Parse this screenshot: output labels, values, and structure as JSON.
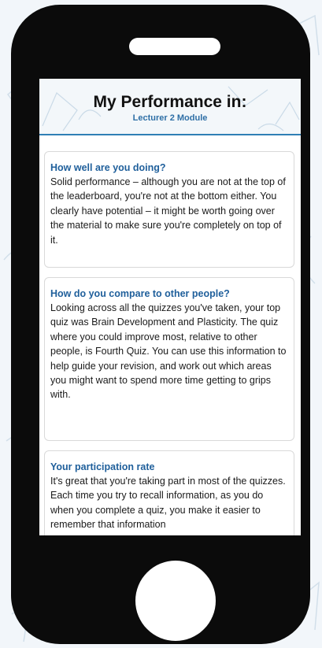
{
  "header": {
    "title": "My Performance in:",
    "subtitle": "Lecturer 2 Module"
  },
  "cards": [
    {
      "title": "How well are you doing?",
      "body": "Solid performance – although you are not at the top of the leaderboard, you're not at the bottom either. You clearly have potential – it might be worth going over the material to make sure you're completely on top of it."
    },
    {
      "title": "How do you compare to other people?",
      "body": "Looking across all the quizzes you've taken, your top quiz was Brain Development and Plasticity. The quiz where you could improve most, relative to other people, is Fourth Quiz. You can use this information to help guide your revision, and work out which areas you might want to spend more time getting to grips with."
    },
    {
      "title": "Your participation rate",
      "body": "It's great that you're taking part in most of the quizzes. Each time you try to recall information, as you do when you complete a quiz, you make it easier to remember that information"
    }
  ],
  "colors": {
    "phone_body": "#0b0b0b",
    "accent_blue": "#2e6fa6",
    "card_title_blue": "#1f5f9b"
  }
}
